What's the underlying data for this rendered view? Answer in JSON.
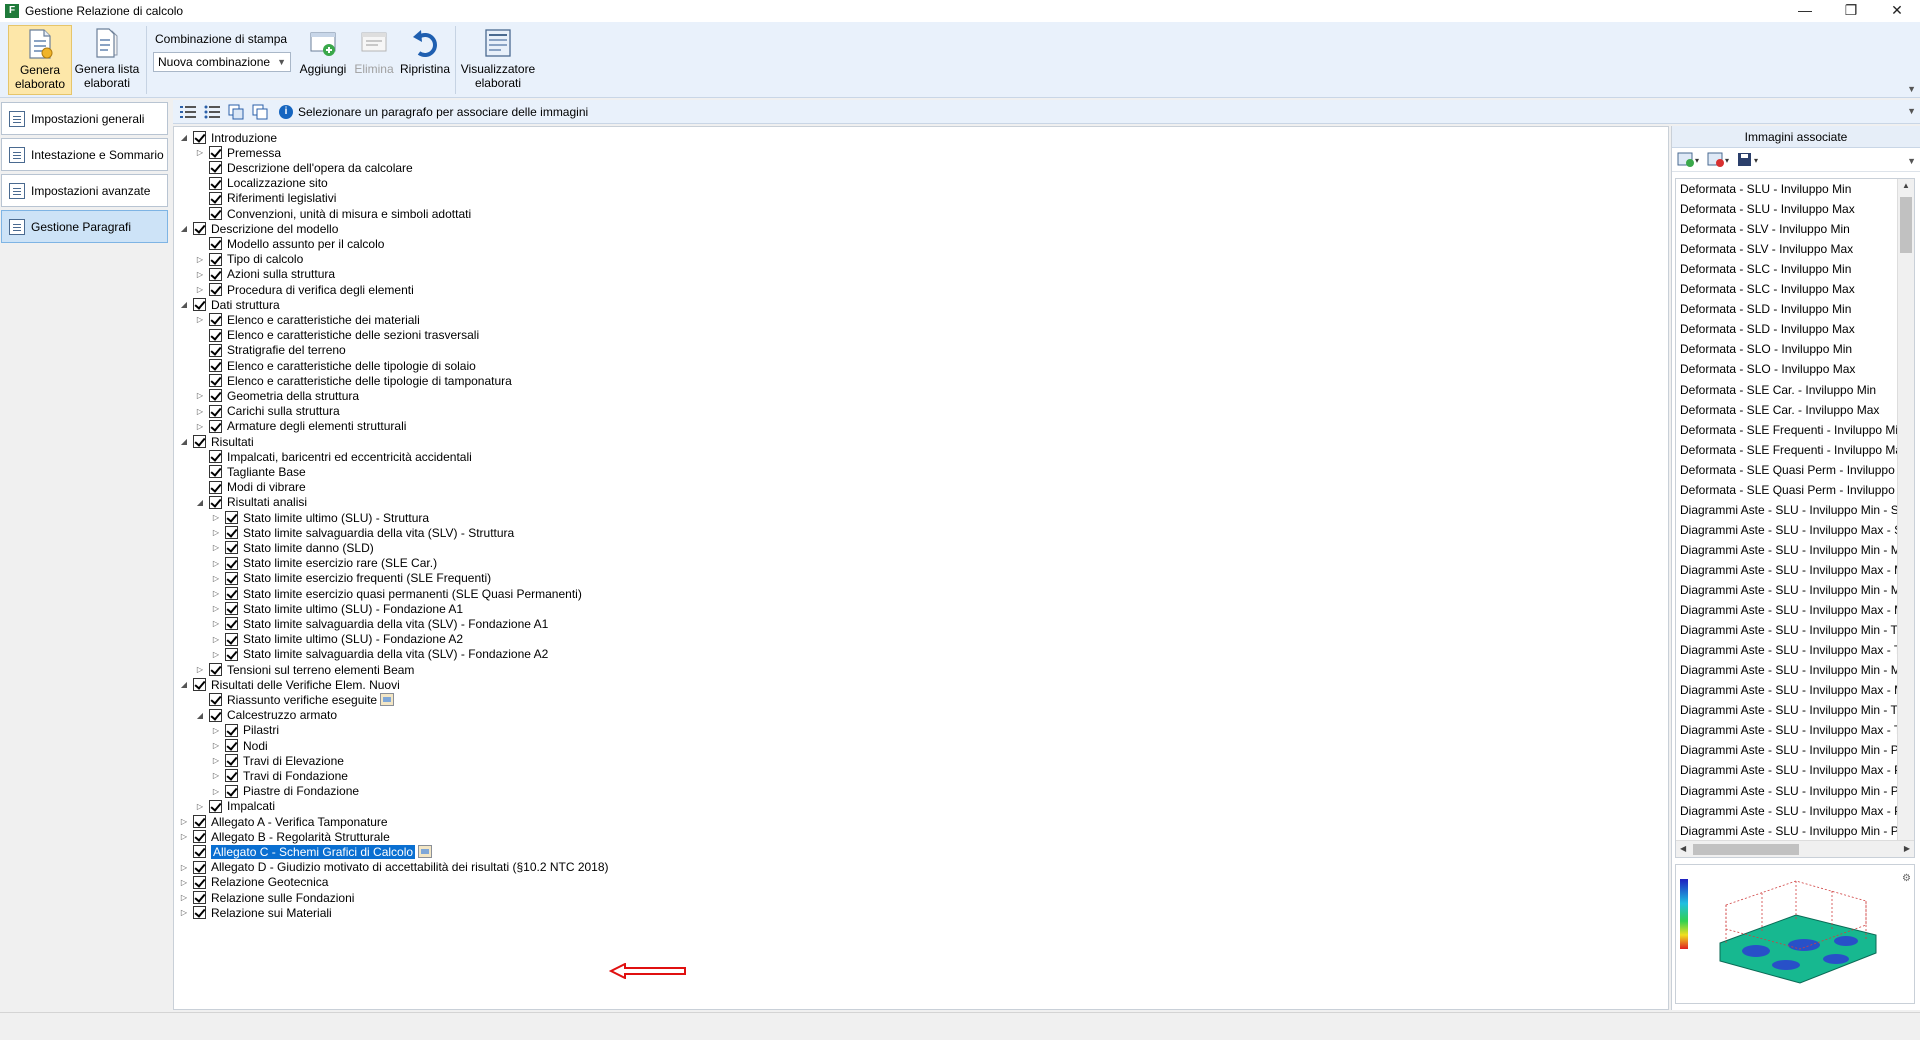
{
  "window": {
    "title": "Gestione Relazione di calcolo",
    "app_icon_letter": "F",
    "minimize": "—",
    "maximize": "❐",
    "close": "✕"
  },
  "ribbon": {
    "genera_elaborato": "Genera\nelaborato",
    "genera_lista": "Genera lista\nelaborati",
    "combinazione_label": "Combinazione di stampa",
    "combinazione_value": "Nuova combinazione",
    "aggiungi": "Aggiungi",
    "elimina": "Elimina",
    "ripristina": "Ripristina",
    "visualizzatore": "Visualizzatore\nelaborati"
  },
  "sidebar": {
    "items": [
      {
        "label": "Impostazioni generali"
      },
      {
        "label": "Intestazione e Sommario"
      },
      {
        "label": "Impostazioni avanzate"
      },
      {
        "label": "Gestione Paragrafi"
      }
    ]
  },
  "tree_toolbar": {
    "info_text": "Selezionare un paragrafo per associare delle immagini"
  },
  "tree": [
    {
      "label": "Introduzione",
      "level": 0,
      "exp": "open"
    },
    {
      "label": "Premessa",
      "level": 1,
      "exp": "closed"
    },
    {
      "label": "Descrizione dell'opera da calcolare",
      "level": 1,
      "exp": "none"
    },
    {
      "label": "Localizzazione sito",
      "level": 1,
      "exp": "none"
    },
    {
      "label": "Riferimenti legislativi",
      "level": 1,
      "exp": "none"
    },
    {
      "label": "Convenzioni, unità di misura e simboli adottati",
      "level": 1,
      "exp": "none"
    },
    {
      "label": "Descrizione del modello",
      "level": 0,
      "exp": "open"
    },
    {
      "label": "Modello assunto per il calcolo",
      "level": 1,
      "exp": "none"
    },
    {
      "label": "Tipo di calcolo",
      "level": 1,
      "exp": "closed"
    },
    {
      "label": "Azioni sulla struttura",
      "level": 1,
      "exp": "closed"
    },
    {
      "label": "Procedura di verifica degli elementi",
      "level": 1,
      "exp": "closed"
    },
    {
      "label": "Dati struttura",
      "level": 0,
      "exp": "open"
    },
    {
      "label": "Elenco e caratteristiche dei materiali",
      "level": 1,
      "exp": "closed"
    },
    {
      "label": "Elenco e caratteristiche delle sezioni trasversali",
      "level": 1,
      "exp": "none"
    },
    {
      "label": "Stratigrafie del terreno",
      "level": 1,
      "exp": "none"
    },
    {
      "label": "Elenco e caratteristiche delle tipologie di solaio",
      "level": 1,
      "exp": "none"
    },
    {
      "label": "Elenco e caratteristiche delle tipologie di tamponatura",
      "level": 1,
      "exp": "none"
    },
    {
      "label": "Geometria della struttura",
      "level": 1,
      "exp": "closed"
    },
    {
      "label": "Carichi sulla struttura",
      "level": 1,
      "exp": "closed"
    },
    {
      "label": "Armature degli elementi strutturali",
      "level": 1,
      "exp": "closed"
    },
    {
      "label": "Risultati",
      "level": 0,
      "exp": "open"
    },
    {
      "label": "Impalcati, baricentri ed eccentricità accidentali",
      "level": 1,
      "exp": "none"
    },
    {
      "label": "Tagliante Base",
      "level": 1,
      "exp": "none"
    },
    {
      "label": "Modi di vibrare",
      "level": 1,
      "exp": "none"
    },
    {
      "label": "Risultati analisi",
      "level": 1,
      "exp": "open"
    },
    {
      "label": "Stato limite ultimo (SLU) - Struttura",
      "level": 2,
      "exp": "closed"
    },
    {
      "label": "Stato limite salvaguardia della vita (SLV) - Struttura",
      "level": 2,
      "exp": "closed"
    },
    {
      "label": "Stato limite danno (SLD)",
      "level": 2,
      "exp": "closed"
    },
    {
      "label": "Stato limite esercizio rare (SLE Car.)",
      "level": 2,
      "exp": "closed"
    },
    {
      "label": "Stato limite esercizio frequenti (SLE Frequenti)",
      "level": 2,
      "exp": "closed"
    },
    {
      "label": "Stato limite esercizio quasi permanenti (SLE Quasi Permanenti)",
      "level": 2,
      "exp": "closed"
    },
    {
      "label": "Stato limite ultimo (SLU) - Fondazione A1",
      "level": 2,
      "exp": "closed"
    },
    {
      "label": "Stato limite salvaguardia della vita (SLV) - Fondazione A1",
      "level": 2,
      "exp": "closed"
    },
    {
      "label": "Stato limite ultimo (SLU) - Fondazione A2",
      "level": 2,
      "exp": "closed"
    },
    {
      "label": "Stato limite salvaguardia della vita (SLV) - Fondazione A2",
      "level": 2,
      "exp": "closed"
    },
    {
      "label": "Tensioni sul terreno elementi Beam",
      "level": 1,
      "exp": "closed"
    },
    {
      "label": "Risultati delle Verifiche Elem. Nuovi",
      "level": 0,
      "exp": "open"
    },
    {
      "label": "Riassunto verifiche eseguite",
      "level": 1,
      "exp": "none",
      "badge": true
    },
    {
      "label": "Calcestruzzo armato",
      "level": 1,
      "exp": "open"
    },
    {
      "label": "Pilastri",
      "level": 2,
      "exp": "closed"
    },
    {
      "label": "Nodi",
      "level": 2,
      "exp": "closed"
    },
    {
      "label": "Travi di Elevazione",
      "level": 2,
      "exp": "closed"
    },
    {
      "label": "Travi di Fondazione",
      "level": 2,
      "exp": "closed"
    },
    {
      "label": "Piastre di Fondazione",
      "level": 2,
      "exp": "closed"
    },
    {
      "label": "Impalcati",
      "level": 1,
      "exp": "closed"
    },
    {
      "label": "Allegato A - Verifica Tamponature",
      "level": 0,
      "exp": "closed"
    },
    {
      "label": "Allegato B - Regolarità Strutturale",
      "level": 0,
      "exp": "closed"
    },
    {
      "label": "Allegato C - Schemi Grafici di Calcolo",
      "level": 0,
      "exp": "none",
      "badge": true,
      "selected": true
    },
    {
      "label": "Allegato D - Giudizio motivato di accettabilità dei risultati (§10.2 NTC 2018)",
      "level": 0,
      "exp": "closed"
    },
    {
      "label": "Relazione Geotecnica",
      "level": 0,
      "exp": "closed"
    },
    {
      "label": "Relazione sulle Fondazioni",
      "level": 0,
      "exp": "closed"
    },
    {
      "label": "Relazione sui Materiali",
      "level": 0,
      "exp": "closed"
    }
  ],
  "right_panel": {
    "header": "Immagini associate",
    "images": [
      "Deformata - SLU - Inviluppo Min",
      "Deformata - SLU - Inviluppo Max",
      "Deformata - SLV - Inviluppo Min",
      "Deformata - SLV - Inviluppo Max",
      "Deformata - SLC - Inviluppo Min",
      "Deformata - SLC - Inviluppo Max",
      "Deformata - SLD - Inviluppo Min",
      "Deformata - SLD - Inviluppo Max",
      "Deformata - SLO - Inviluppo Min",
      "Deformata - SLO - Inviluppo Max",
      "Deformata - SLE Car. - Inviluppo Min",
      "Deformata - SLE Car. - Inviluppo Max",
      "Deformata - SLE Frequenti - Inviluppo Min",
      "Deformata - SLE Frequenti - Inviluppo Max",
      "Deformata - SLE Quasi Perm - Inviluppo M",
      "Deformata - SLE Quasi Perm - Inviluppo M",
      "Diagrammi Aste - SLU - Inviluppo Min - Sf",
      "Diagrammi Aste - SLU - Inviluppo Max - Sf",
      "Diagrammi Aste - SLU - Inviluppo Min - M",
      "Diagrammi Aste - SLU - Inviluppo Max - M",
      "Diagrammi Aste - SLU - Inviluppo Min - M",
      "Diagrammi Aste - SLU - Inviluppo Max - M",
      "Diagrammi Aste - SLU - Inviluppo Min - Ta",
      "Diagrammi Aste - SLU - Inviluppo Max - Ta",
      "Diagrammi Aste - SLU - Inviluppo Min - M",
      "Diagrammi Aste - SLU - Inviluppo Max - M",
      "Diagrammi Aste - SLU - Inviluppo Min - Ta",
      "Diagrammi Aste - SLU - Inviluppo Max - Ta",
      "Diagrammi Aste - SLU - Inviluppo Min - Pr",
      "Diagrammi Aste - SLU - Inviluppo Max - Pr",
      "Diagrammi Aste - SLU - Inviluppo Min - Pr",
      "Diagrammi Aste - SLU - Inviluppo Max - Pr",
      "Diagrammi Aste - SLU - Inviluppo Min - Pr"
    ]
  },
  "colors": {
    "selection": "#0a6fd1",
    "ribbon_bg": "#e9f1fb",
    "active_sidebar": "#cde3f7",
    "arrow": "#e01010"
  }
}
